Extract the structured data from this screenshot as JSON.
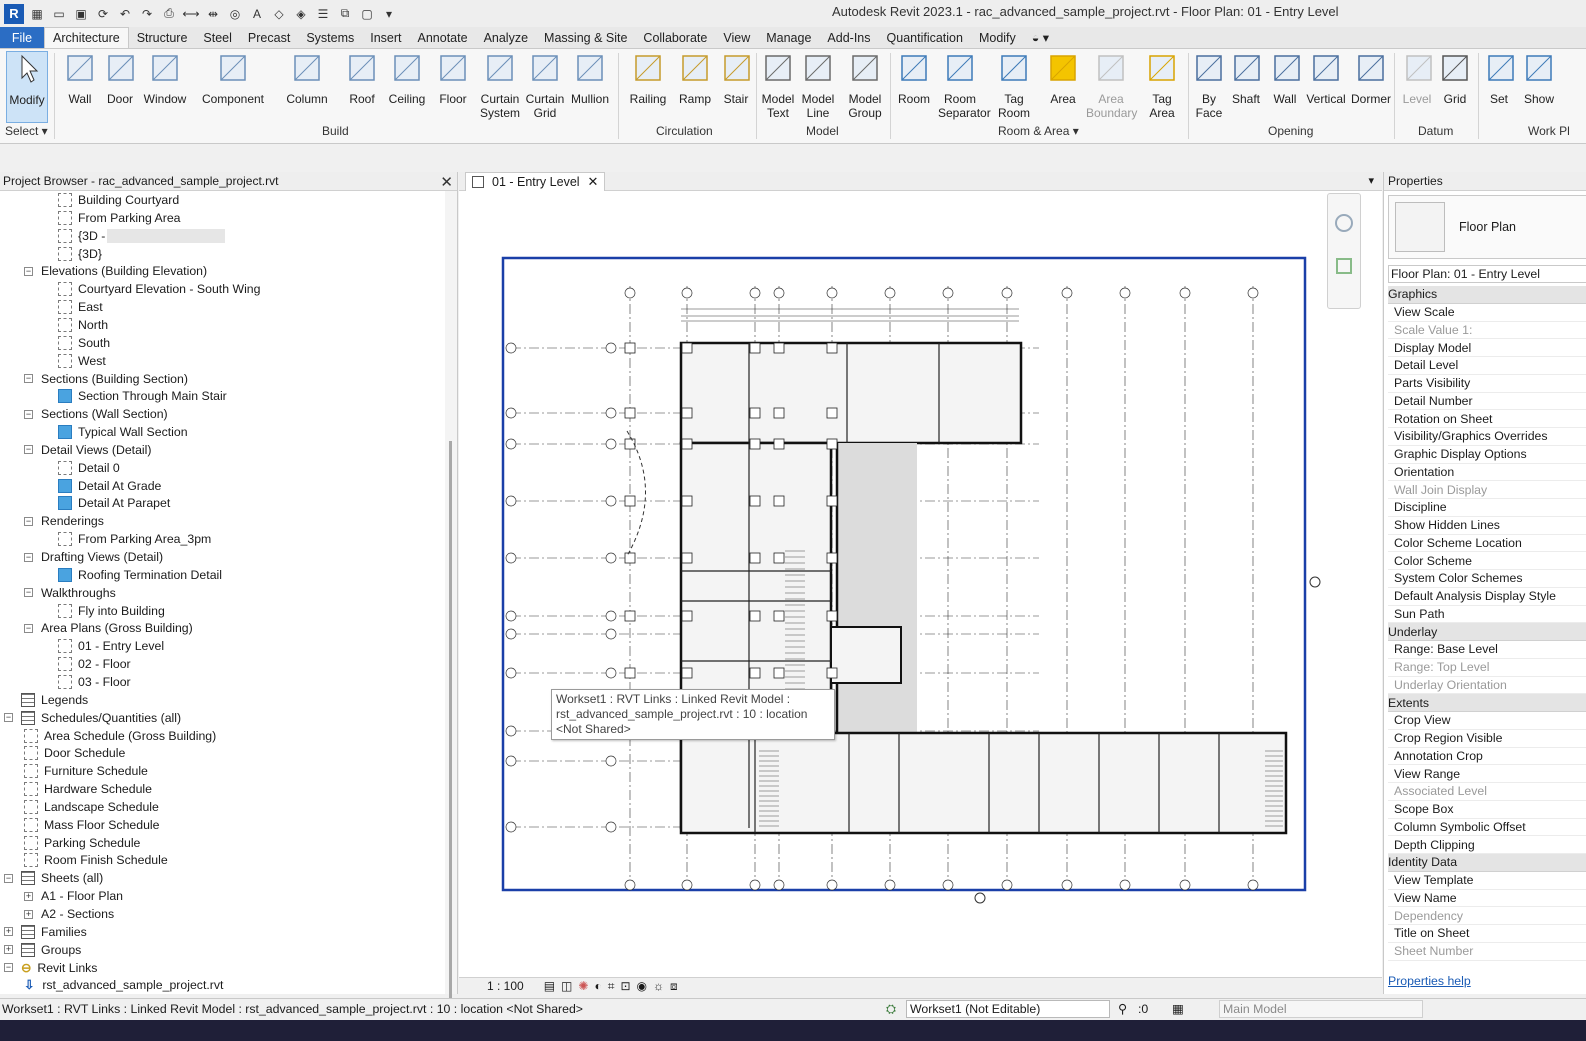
{
  "window": {
    "title": "Autodesk Revit 2023.1 - rac_advanced_sample_project.rvt - Floor Plan: 01 - Entry Level",
    "app_logo": "R"
  },
  "ribbon_tabs": [
    "File",
    "Architecture",
    "Structure",
    "Steel",
    "Precast",
    "Systems",
    "Insert",
    "Annotate",
    "Analyze",
    "Massing & Site",
    "Collaborate",
    "View",
    "Manage",
    "Add-Ins",
    "Quantification",
    "Modify"
  ],
  "ribbon": {
    "modify": {
      "label": "Modify",
      "sub": "Select ▾"
    },
    "build": {
      "label": "Build",
      "buttons": [
        "Wall",
        "Door",
        "Window",
        "Component",
        "Column",
        "Roof",
        "Ceiling",
        "Floor",
        "Curtain System",
        "Curtain Grid",
        "Mullion"
      ]
    },
    "circulation": {
      "label": "Circulation",
      "buttons": [
        "Railing",
        "Ramp",
        "Stair"
      ]
    },
    "model": {
      "label": "Model",
      "buttons": [
        "Model Text",
        "Model Line",
        "Model Group"
      ]
    },
    "room_area": {
      "label": "Room & Area ▾",
      "buttons": [
        "Room",
        "Room Separator",
        "Tag Room",
        "Area",
        "Area Boundary",
        "Tag Area"
      ]
    },
    "opening": {
      "label": "Opening",
      "buttons": [
        "By Face",
        "Shaft",
        "Wall",
        "Vertical",
        "Dormer"
      ]
    },
    "datum": {
      "label": "Datum",
      "buttons": [
        "Level",
        "Grid"
      ]
    },
    "workplane": {
      "label": "Work Pl",
      "buttons": [
        "Set",
        "Show"
      ]
    }
  },
  "project_browser": {
    "title": "Project Browser - rac_advanced_sample_project.rvt",
    "rows": [
      {
        "text": "Building Courtyard",
        "level": 3,
        "icon": "view"
      },
      {
        "text": "From Parking Area",
        "level": 3,
        "icon": "view"
      },
      {
        "text": "{3D -",
        "level": 3,
        "icon": "view",
        "blur": true
      },
      {
        "text": "{3D}",
        "level": 3,
        "icon": "view"
      },
      {
        "text": "Elevations (Building Elevation)",
        "level": 2,
        "exp": "−"
      },
      {
        "text": "Courtyard Elevation - South Wing",
        "level": 3,
        "icon": "view"
      },
      {
        "text": "East",
        "level": 3,
        "icon": "view"
      },
      {
        "text": "North",
        "level": 3,
        "icon": "view"
      },
      {
        "text": "South",
        "level": 3,
        "icon": "view"
      },
      {
        "text": "West",
        "level": 3,
        "icon": "view"
      },
      {
        "text": "Sections (Building Section)",
        "level": 2,
        "exp": "−"
      },
      {
        "text": "Section Through Main Stair",
        "level": 3,
        "icon": "filled"
      },
      {
        "text": "Sections (Wall Section)",
        "level": 2,
        "exp": "−"
      },
      {
        "text": "Typical Wall Section",
        "level": 3,
        "icon": "filled"
      },
      {
        "text": "Detail Views (Detail)",
        "level": 2,
        "exp": "−"
      },
      {
        "text": "Detail 0",
        "level": 3,
        "icon": "view"
      },
      {
        "text": "Detail At Grade",
        "level": 3,
        "icon": "filled"
      },
      {
        "text": "Detail At Parapet",
        "level": 3,
        "icon": "filled"
      },
      {
        "text": "Renderings",
        "level": 2,
        "exp": "−"
      },
      {
        "text": "From Parking Area_3pm",
        "level": 3,
        "icon": "view"
      },
      {
        "text": "Drafting Views (Detail)",
        "level": 2,
        "exp": "−"
      },
      {
        "text": "Roofing Termination Detail",
        "level": 3,
        "icon": "filled"
      },
      {
        "text": "Walkthroughs",
        "level": 2,
        "exp": "−"
      },
      {
        "text": "Fly into Building",
        "level": 3,
        "icon": "view"
      },
      {
        "text": "Area Plans (Gross Building)",
        "level": 2,
        "exp": "−"
      },
      {
        "text": "01 - Entry Level",
        "level": 3,
        "icon": "view"
      },
      {
        "text": "02 - Floor",
        "level": 3,
        "icon": "view"
      },
      {
        "text": "03 - Floor",
        "level": 3,
        "icon": "view"
      },
      {
        "text": "Legends",
        "level": 1,
        "icon": "grid"
      },
      {
        "text": "Schedules/Quantities (all)",
        "level": 1,
        "exp": "−",
        "icon": "grid"
      },
      {
        "text": "Area Schedule (Gross Building)",
        "level": 2,
        "icon": "view"
      },
      {
        "text": "Door Schedule",
        "level": 2,
        "icon": "view"
      },
      {
        "text": "Furniture Schedule",
        "level": 2,
        "icon": "view"
      },
      {
        "text": "Hardware Schedule",
        "level": 2,
        "icon": "view"
      },
      {
        "text": "Landscape Schedule",
        "level": 2,
        "icon": "view"
      },
      {
        "text": "Mass Floor Schedule",
        "level": 2,
        "icon": "view"
      },
      {
        "text": "Parking Schedule",
        "level": 2,
        "icon": "view"
      },
      {
        "text": "Room Finish Schedule",
        "level": 2,
        "icon": "view"
      },
      {
        "text": "Sheets (all)",
        "level": 1,
        "exp": "−",
        "icon": "grid"
      },
      {
        "text": "A1 - Floor Plan",
        "level": 2,
        "exp": "+"
      },
      {
        "text": "A2 - Sections",
        "level": 2,
        "exp": "+"
      },
      {
        "text": "Families",
        "level": 1,
        "exp": "+",
        "icon": "grid"
      },
      {
        "text": "Groups",
        "level": 1,
        "exp": "+",
        "icon": "grid"
      },
      {
        "text": "Revit Links",
        "level": 1,
        "exp": "−",
        "icon": "link"
      },
      {
        "text": "rst_advanced_sample_project.rvt",
        "level": 2,
        "icon": "arrow"
      }
    ]
  },
  "view": {
    "tab_label": "01 - Entry Level",
    "scale": "1 : 100",
    "tooltip": "Workset1 : RVT Links : Linked Revit Model : rst_advanced_sample_project.rvt : 10 : location <Not Shared>"
  },
  "properties": {
    "title": "Properties",
    "type_name": "Floor Plan",
    "instance": "Floor Plan: 01 - Entry Level",
    "rows": [
      {
        "text": "Graphics",
        "group": true
      },
      {
        "text": "View Scale"
      },
      {
        "text": "Scale Value    1:",
        "disabled": true
      },
      {
        "text": "Display Model"
      },
      {
        "text": "Detail Level"
      },
      {
        "text": "Parts Visibility"
      },
      {
        "text": "Detail Number"
      },
      {
        "text": "Rotation on Sheet"
      },
      {
        "text": "Visibility/Graphics Overrides"
      },
      {
        "text": "Graphic Display Options"
      },
      {
        "text": "Orientation"
      },
      {
        "text": "Wall Join Display",
        "disabled": true
      },
      {
        "text": "Discipline"
      },
      {
        "text": "Show Hidden Lines"
      },
      {
        "text": "Color Scheme Location"
      },
      {
        "text": "Color Scheme"
      },
      {
        "text": "System Color Schemes"
      },
      {
        "text": "Default Analysis Display Style"
      },
      {
        "text": "Sun Path"
      },
      {
        "text": "Underlay",
        "group": true
      },
      {
        "text": "Range: Base Level"
      },
      {
        "text": "Range: Top Level",
        "disabled": true
      },
      {
        "text": "Underlay Orientation",
        "disabled": true
      },
      {
        "text": "Extents",
        "group": true
      },
      {
        "text": "Crop View"
      },
      {
        "text": "Crop Region Visible"
      },
      {
        "text": "Annotation Crop"
      },
      {
        "text": "View Range"
      },
      {
        "text": "Associated Level",
        "disabled": true
      },
      {
        "text": "Scope Box"
      },
      {
        "text": "Column Symbolic Offset"
      },
      {
        "text": "Depth Clipping"
      },
      {
        "text": "Identity Data",
        "group": true
      },
      {
        "text": "View Template"
      },
      {
        "text": "View Name"
      },
      {
        "text": "Dependency",
        "disabled": true
      },
      {
        "text": "Title on Sheet"
      },
      {
        "text": "Sheet Number",
        "disabled": true
      }
    ],
    "help_link": "Properties help"
  },
  "status": {
    "text": "Workset1 : RVT Links : Linked Revit Model : rst_advanced_sample_project.rvt : 10 : location <Not Shared>",
    "workset": "Workset1 (Not Editable)",
    "count": ":0",
    "main_model": "Main Model"
  }
}
